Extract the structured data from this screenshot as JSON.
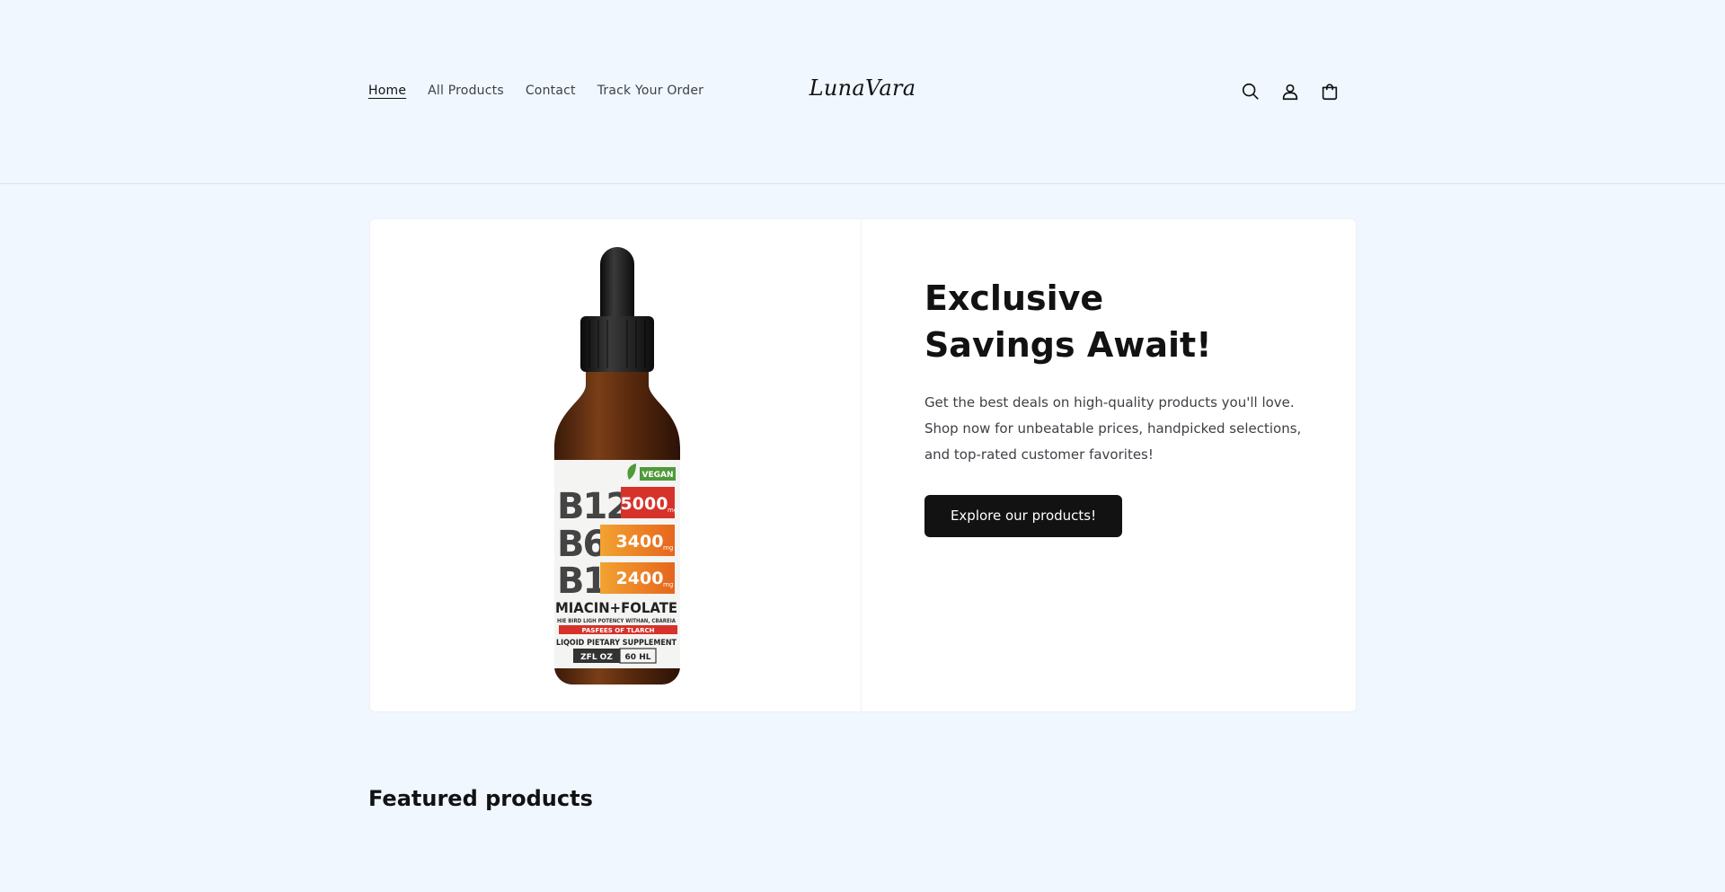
{
  "header": {
    "nav": [
      {
        "label": "Home",
        "active": true
      },
      {
        "label": "All Products"
      },
      {
        "label": "Contact"
      },
      {
        "label": "Track Your Order"
      }
    ],
    "logo": "LunaVara",
    "icons": [
      "search-icon",
      "account-icon",
      "cart-icon"
    ]
  },
  "hero": {
    "title": "Exclusive Savings Await!",
    "description": "Get the best deals on high-quality products you'll love. Shop now for unbeatable prices, handpicked selections, and top-rated customer favorites!",
    "cta_label": "Explore our products!",
    "product_label": {
      "badge": "VEGAN",
      "rows": [
        {
          "name": "B12",
          "dose": "5000",
          "unit": "mg"
        },
        {
          "name": "B6",
          "dose": "3400",
          "unit": "mg"
        },
        {
          "name": "B1",
          "dose": "2400",
          "unit": "mg"
        }
      ],
      "line1": "MIACIN+FOLATE",
      "line2": "HIE BIRD LIGH POTENCY WITHAN, CBAREIA",
      "line3": "PASFEES OF TLARCH",
      "line4": "LIQOID PIETARY SUPPLEMENT",
      "size1": "ZFL OZ",
      "size2": "60 HL"
    }
  },
  "featured": {
    "title": "Featured products"
  },
  "colors": {
    "background": "#f0f7ff",
    "button": "#121212",
    "text": "#121212"
  }
}
